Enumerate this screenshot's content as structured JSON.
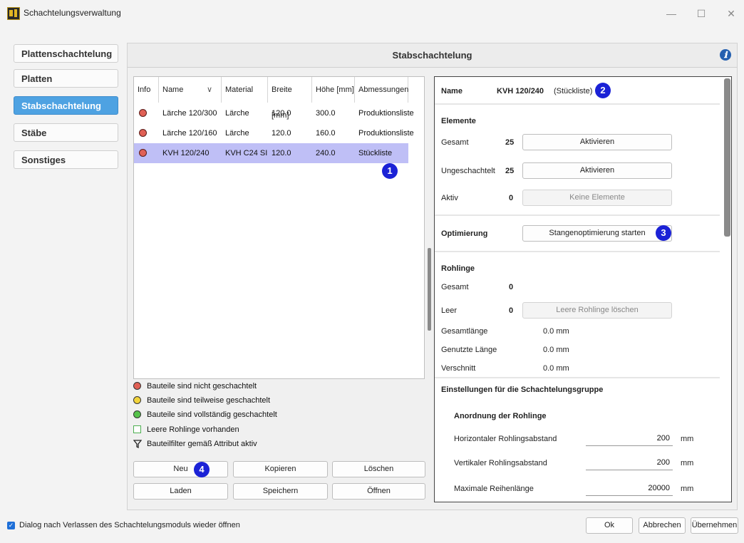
{
  "window": {
    "title": "Schachtelungsverwaltung",
    "minimize": "—",
    "maximize": "☐",
    "close": "✕"
  },
  "nav": {
    "items": [
      "Plattenschachtelung",
      "Platten",
      "Stabschachtelung",
      "Stäbe",
      "Sonstiges"
    ],
    "active_index": 2
  },
  "main": {
    "header": "Stabschachtelung",
    "info_icon": "ℹ"
  },
  "table": {
    "headers": [
      "Info",
      "Name",
      "Material",
      "Breite [mm]",
      "Höhe [mm]",
      "Abmessungen"
    ],
    "sort_indicator": "∨",
    "rows": [
      {
        "name": "Lärche 120/300",
        "material": "Lärche",
        "breite": "120.0",
        "hoehe": "300.0",
        "abmessungen": "Produktionsliste"
      },
      {
        "name": "Lärche 120/160",
        "material": "Lärche",
        "breite": "120.0",
        "hoehe": "160.0",
        "abmessungen": "Produktionsliste"
      },
      {
        "name": "KVH 120/240",
        "material": "KVH C24 SI",
        "breite": "120.0",
        "hoehe": "240.0",
        "abmessungen": "Stückliste"
      }
    ],
    "selected_index": 2
  },
  "legend": [
    {
      "text": "Bauteile sind nicht geschachtelt",
      "color": "#e06055",
      "shape": "dot"
    },
    {
      "text": "Bauteile sind teilweise geschachtelt",
      "color": "#f2d43c",
      "shape": "dot"
    },
    {
      "text": "Bauteile sind vollständig geschachtelt",
      "color": "#55c24a",
      "shape": "dot"
    },
    {
      "text": "Leere Rohlinge vorhanden",
      "color": "#4caf50",
      "shape": "square-outline"
    },
    {
      "text": "Bauteilfilter gemäß Attribut aktiv",
      "shape": "filter-icon"
    }
  ],
  "buttons": {
    "neu": "Neu",
    "kopieren": "Kopieren",
    "loeschen": "Löschen",
    "laden": "Laden",
    "speichern": "Speichern",
    "oeffnen": "Öffnen"
  },
  "details": {
    "name_label": "Name",
    "name_value": "KVH 120/240",
    "name_suffix": "(Stückliste)",
    "elemente": {
      "heading": "Elemente",
      "gesamt_label": "Gesamt",
      "gesamt_value": "25",
      "gesamt_button": "Aktivieren",
      "ungeschachtelt_label": "Ungeschachtelt",
      "ungeschachtelt_value": "25",
      "ungeschachtelt_button": "Aktivieren",
      "aktiv_label": "Aktiv",
      "aktiv_value": "0",
      "aktiv_button": "Keine Elemente"
    },
    "optimierung": {
      "label": "Optimierung",
      "button": "Stangenoptimierung starten"
    },
    "rohlinge": {
      "heading": "Rohlinge",
      "gesamt_label": "Gesamt",
      "gesamt_value": "0",
      "leer_label": "Leer",
      "leer_value": "0",
      "leer_button": "Leere Rohlinge löschen",
      "gesamtlaenge_label": "Gesamtlänge",
      "gesamtlaenge_value": "0.0 mm",
      "genutzt_label": "Genutzte Länge",
      "genutzt_value": "0.0 mm",
      "verschnitt_label": "Verschnitt",
      "verschnitt_value": "0.0 mm"
    },
    "einstellungen": {
      "heading": "Einstellungen für die Schachtelungsgruppe",
      "subheading": "Anordnung der Rohlinge",
      "horizontal_label": "Horizontaler Rohlingsabstand",
      "horizontal_value": "200",
      "horizontal_unit": "mm",
      "vertikal_label": "Vertikaler Rohlingsabstand",
      "vertikal_value": "200",
      "vertikal_unit": "mm",
      "reihenlaenge_label": "Maximale Reihenlänge",
      "reihenlaenge_value": "20000",
      "reihenlaenge_unit": "mm"
    }
  },
  "badges": [
    "1",
    "2",
    "3",
    "4"
  ],
  "footer": {
    "checkbox_label": "Dialog nach Verlassen des Schachtelungsmoduls wieder öffnen",
    "checkbox_checked": true,
    "ok": "Ok",
    "abbrechen": "Abbrechen",
    "uebernehmen": "Übernehmen"
  }
}
